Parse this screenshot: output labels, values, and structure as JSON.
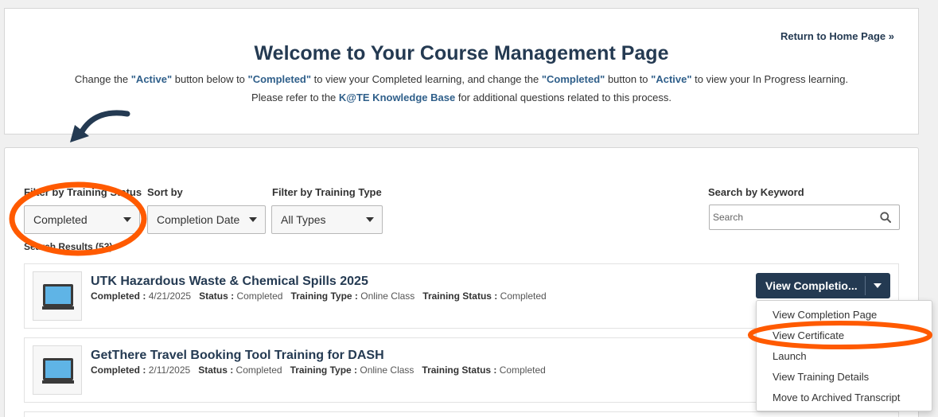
{
  "header": {
    "home_link": "Return to Home Page »",
    "title": "Welcome to Your Course Management Page",
    "line1": {
      "t1": "Change the ",
      "q1": "\"Active\"",
      "t2": " button below to ",
      "q2": "\"Completed\"",
      "t3": " to view your Completed learning, and change the ",
      "q3": "\"Completed\"",
      "t4": " button to ",
      "q4": "\"Active\"",
      "t5": " to view your In Progress learning."
    },
    "line2": {
      "t1": "Please refer to the ",
      "link": "K@TE Knowledge Base",
      "t2": " for additional questions related to this process."
    }
  },
  "filters": {
    "status_label": "Filter by Training Status",
    "status_value": "Completed",
    "sort_label": "Sort by",
    "sort_value": "Completion Date",
    "type_label": "Filter by Training Type",
    "type_value": "All Types",
    "search_label": "Search by Keyword",
    "search_placeholder": "Search"
  },
  "results_count": "Search Results (53)",
  "meta_keys": {
    "completed": "Completed :",
    "status": "Status :",
    "training_type": "Training Type :",
    "training_status": "Training Status :"
  },
  "results": [
    {
      "title": "UTK Hazardous Waste & Chemical Spills 2025",
      "completed": "4/21/2025",
      "status": "Completed",
      "training_type": "Online Class",
      "training_status": "Completed",
      "action": "View Completio..."
    },
    {
      "title": "GetThere Travel Booking Tool Training for DASH",
      "completed": "2/11/2025",
      "status": "Completed",
      "training_type": "Online Class",
      "training_status": "Completed"
    }
  ],
  "action_menu": [
    "View Completion Page",
    "View Certificate",
    "Launch",
    "View Training Details",
    "Move to Archived Transcript"
  ],
  "colors": {
    "navy": "#243a52",
    "link_blue": "#2f5f8a",
    "annotation_orange": "#ff5a00"
  },
  "icons": [
    "search-icon",
    "laptop-icon",
    "curved-arrow-icon",
    "caret-down-icon"
  ]
}
